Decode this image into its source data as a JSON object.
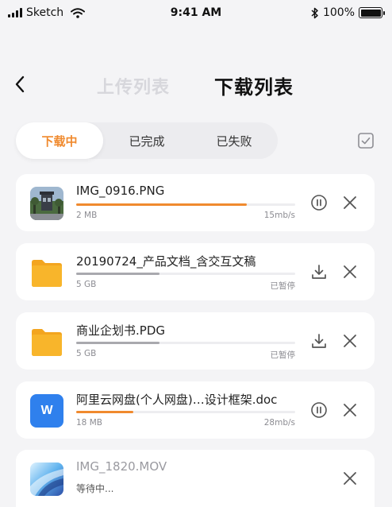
{
  "status_bar": {
    "carrier": "Sketch",
    "time": "9:41 AM",
    "battery": "100%"
  },
  "header": {
    "tab_upload": "上传列表",
    "tab_download": "下载列表"
  },
  "segment": {
    "items": [
      "下载中",
      "已完成",
      "已失败"
    ],
    "active_index": 0
  },
  "files": [
    {
      "name": "IMG_0916.PNG",
      "size": "2 MB",
      "status": "15mb/s",
      "progress": 0.78,
      "state": "downloading",
      "thumb": "photo-icon"
    },
    {
      "name": "20190724_产品文档_含交互文稿",
      "size": "5 GB",
      "status": "已暂停",
      "progress": 0.38,
      "state": "paused",
      "thumb": "folder-icon"
    },
    {
      "name": "商业企划书.PDG",
      "size": "5 GB",
      "status": "已暂停",
      "progress": 0.38,
      "state": "paused",
      "thumb": "folder-icon"
    },
    {
      "name": "阿里云网盘(个人网盘)…设计框架.doc",
      "size": "18 MB",
      "status": "28mb/s",
      "progress": 0.26,
      "state": "downloading",
      "thumb": "word-doc-icon",
      "thumb_letter": "W"
    },
    {
      "name": "IMG_1820.MOV",
      "waiting": "等待中...",
      "state": "waiting",
      "thumb": "video-icon"
    }
  ],
  "colors": {
    "accent": "#f08a2e",
    "folder": "#f8b52b",
    "word": "#2f80ed",
    "background": "#f4f4f6"
  }
}
